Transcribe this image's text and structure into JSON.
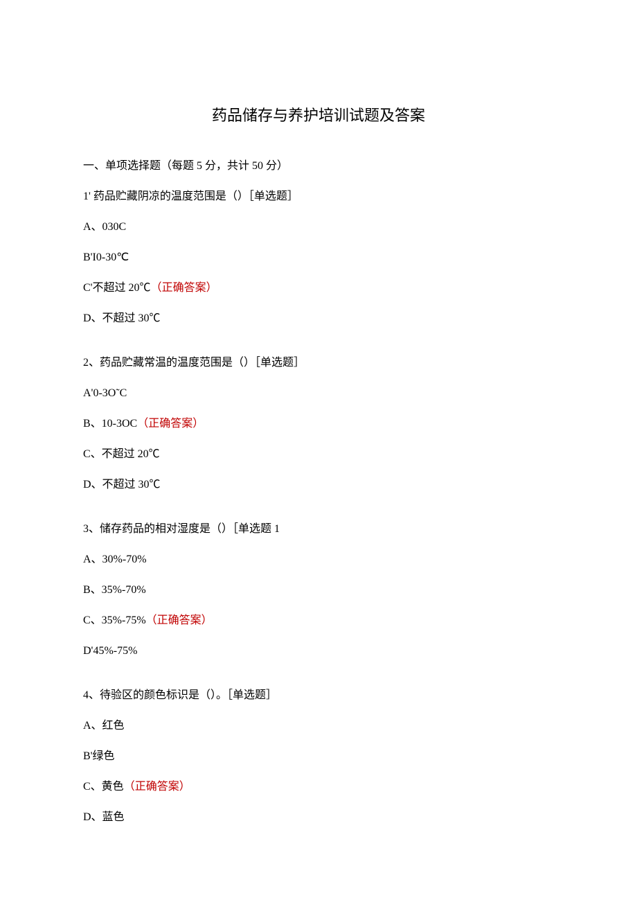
{
  "title": "药品储存与养护培训试题及答案",
  "sectionHeader": "一、单项选择题（每题 5 分，共计 50 分）",
  "correctLabel": "（正确答案）",
  "questions": [
    {
      "stem": "1' 药品贮藏阴凉的温度范围是（）［单选题］",
      "options": [
        {
          "text": "A、030C",
          "correct": false
        },
        {
          "text": "B'I0-30℃",
          "correct": false
        },
        {
          "text": "C'不超过 20℃",
          "correct": true
        },
        {
          "text": "D、不超过 30℃",
          "correct": false
        }
      ]
    },
    {
      "stem": "2、药品贮藏常温的温度范围是（）［单选题］",
      "options": [
        {
          "text": "A'0-3O˜C",
          "correct": false
        },
        {
          "text": "B、10-3OC",
          "correct": true
        },
        {
          "text": "C、不超过 20℃",
          "correct": false
        },
        {
          "text": "D、不超过 30℃",
          "correct": false
        }
      ]
    },
    {
      "stem": "3、储存药品的相对湿度是（）［单选题 1",
      "options": [
        {
          "text": "A、30%-70%",
          "correct": false
        },
        {
          "text": "B、35%-70%",
          "correct": false
        },
        {
          "text": "C、35%-75%",
          "correct": true
        },
        {
          "text": "D'45%-75%",
          "correct": false
        }
      ]
    },
    {
      "stem": "4、待验区的颜色标识是（）。［单选题］",
      "options": [
        {
          "text": "A、红色",
          "correct": false
        },
        {
          "text": "B'绿色",
          "correct": false
        },
        {
          "text": "C、黄色",
          "correct": true
        },
        {
          "text": "D、蓝色",
          "correct": false
        }
      ]
    }
  ]
}
